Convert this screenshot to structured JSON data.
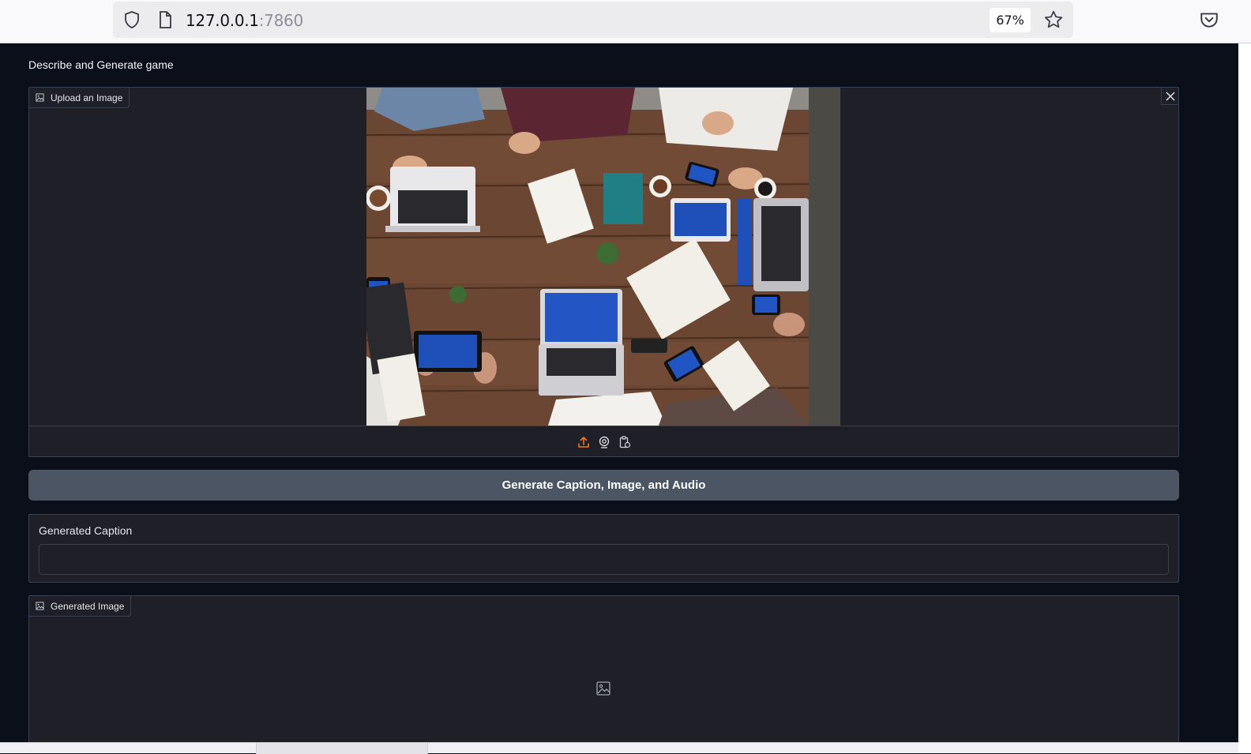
{
  "browser": {
    "url_host": "127.0.0.1",
    "url_port": ":7860",
    "zoom": "67%",
    "icons": [
      "shield-icon",
      "page-icon",
      "star-icon",
      "pocket-icon"
    ]
  },
  "app": {
    "title": "Describe and Generate game",
    "upload": {
      "label": "Upload an Image",
      "tools": [
        "upload-icon",
        "webcam-icon",
        "clipboard-icon"
      ]
    },
    "generate_button": "Generate Caption, Image, and Audio",
    "caption": {
      "label": "Generated Caption",
      "value": ""
    },
    "generated_image": {
      "label": "Generated Image"
    }
  },
  "colors": {
    "background": "#0b0f19",
    "panel": "#1f2027",
    "border": "#374151",
    "button": "#4b5563",
    "accent": "#f97316"
  }
}
